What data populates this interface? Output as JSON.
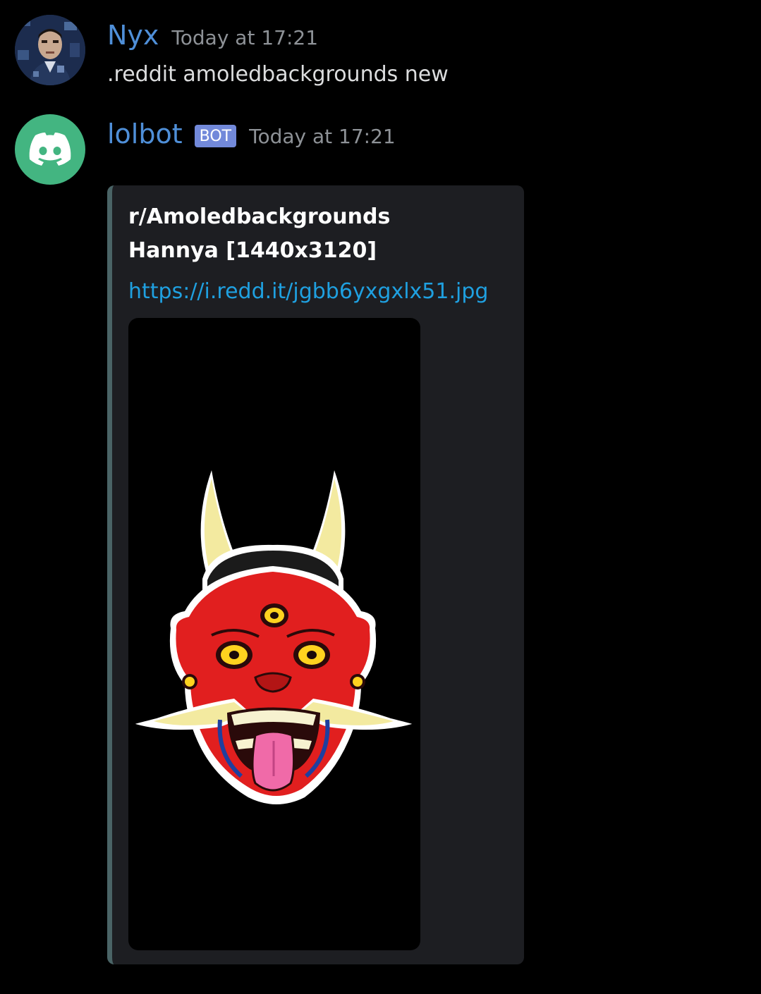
{
  "messages": [
    {
      "author": "Nyx",
      "timestamp": "Today at 17:21",
      "text": ".reddit amoledbackgrounds new",
      "avatar": "user-portrait-avatar"
    },
    {
      "author": "lolbot",
      "badge": "BOT",
      "timestamp": "Today at 17:21",
      "avatar": "discord-logo-icon",
      "embed": {
        "author": "r/Amoledbackgrounds",
        "title": "Hannya [1440x3120]",
        "link": "https://i.redd.it/jgbb6yxgxlx51.jpg",
        "image": "hannya-mask-image",
        "accent_color": "#4a6466"
      }
    }
  ],
  "colors": {
    "username": "#4f8fd8",
    "timestamp": "#8e9297",
    "bot_badge": "#7289da",
    "bot_avatar": "#43b581",
    "link": "#1fa0e0",
    "embed_bg": "#1d1e22"
  }
}
